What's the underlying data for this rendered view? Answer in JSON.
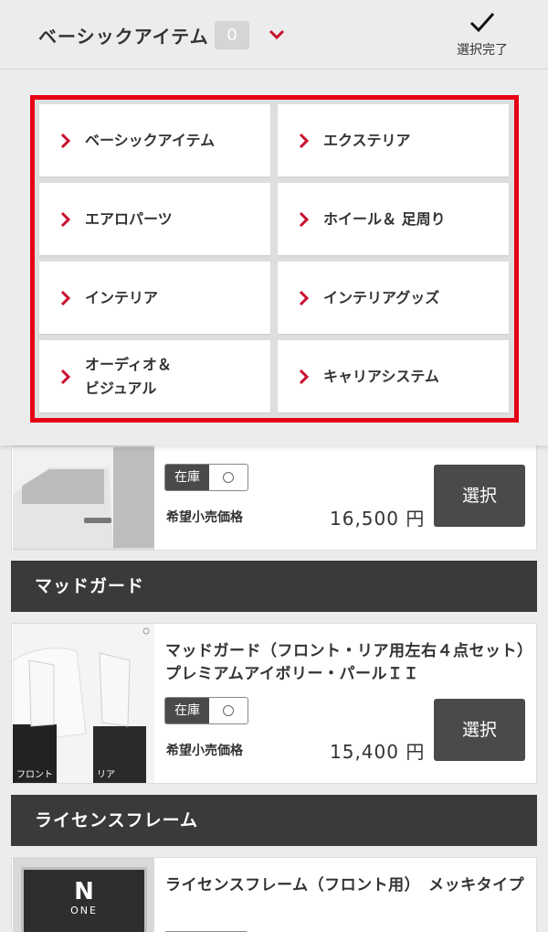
{
  "header": {
    "title": "ベーシックアイテム",
    "count": "0",
    "done_label": "選択完了"
  },
  "categories": [
    {
      "label": "ベーシックアイテム"
    },
    {
      "label": "エクステリア"
    },
    {
      "label": "エアロパーツ"
    },
    {
      "label": "ホイール＆ 足周り"
    },
    {
      "label": "インテリア"
    },
    {
      "label": "インテリアグッズ"
    },
    {
      "label": "オーディオ＆\nビジュアル"
    },
    {
      "label": "キャリアシステム"
    }
  ],
  "products": [
    {
      "name": "",
      "stock_label": "在庫",
      "price_label": "希望小売価格",
      "price": "16,500 円",
      "select_label": "選択"
    },
    {
      "section": "マッドガード",
      "name": "マッドガード（フロント・リア用左右４点セット）　プレミアムアイボリー・パールＩＩ",
      "stock_label": "在庫",
      "price_label": "希望小売価格",
      "price": "15,400 円",
      "select_label": "選択",
      "thumb_captions": [
        "フロント",
        "リア"
      ]
    },
    {
      "section": "ライセンスフレーム",
      "name": "ライセンスフレーム（フロント用）　メッキタイプ",
      "plate_text": [
        "N",
        "ONE"
      ]
    }
  ],
  "colors": {
    "accent_red": "#e60014",
    "chevron_red": "#c8102e",
    "section_bg": "#3a3a3c",
    "button_bg": "#4a4a4a"
  },
  "icons": {
    "done": "checkmark-icon",
    "dropdown": "chevron-down-icon",
    "category": "chevron-right-icon"
  }
}
